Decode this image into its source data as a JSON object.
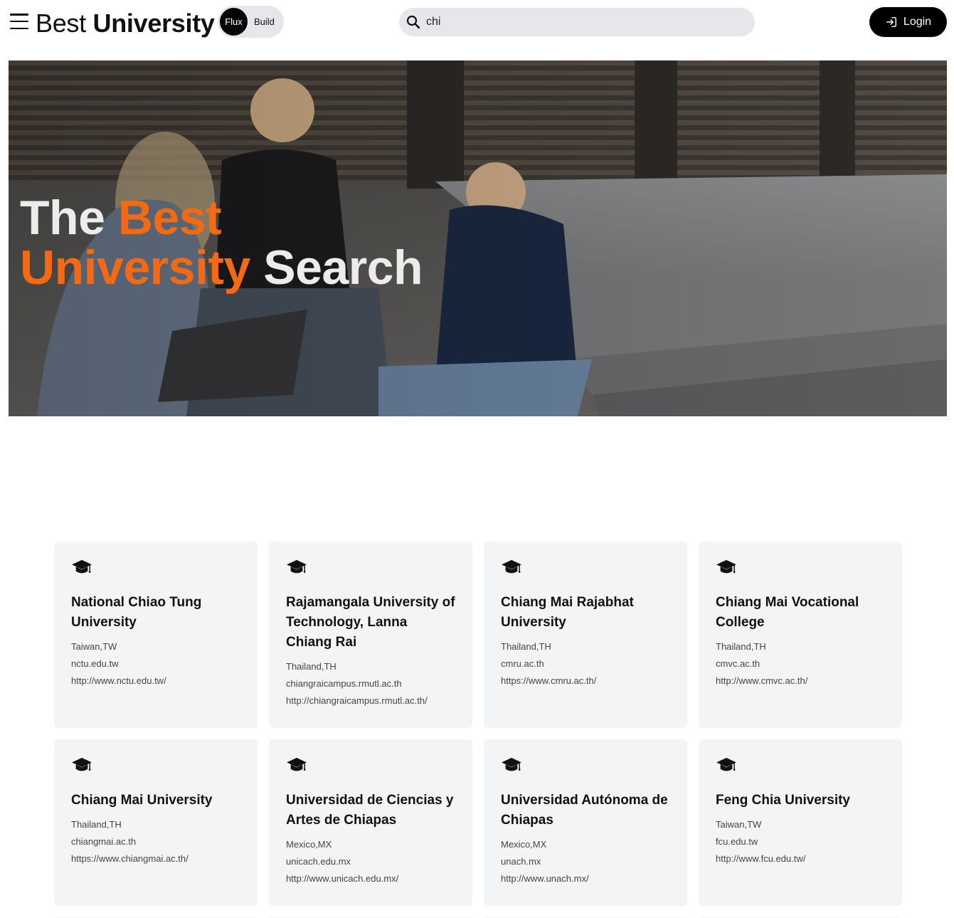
{
  "header": {
    "brand_light": "Best",
    "brand_bold": "University",
    "toggle": {
      "active": "Flux",
      "inactive": "Build"
    },
    "search": {
      "value": "chi",
      "icon": "search-icon"
    },
    "login_label": "Login"
  },
  "hero": {
    "title_word_1": "The",
    "title_word_2": "Best",
    "title_word_3": "University",
    "title_word_4": "Search"
  },
  "colors": {
    "accent": "#f46a12",
    "card_bg": "#f3f4f6",
    "button_bg": "#000000"
  },
  "universities": [
    {
      "name": "National Chiao Tung University",
      "country": "Taiwan,TW",
      "domain": "nctu.edu.tw",
      "url": "http://www.nctu.edu.tw/"
    },
    {
      "name": "Rajamangala University of Technology, Lanna Chiang Rai",
      "country": "Thailand,TH",
      "domain": "chiangraicampus.rmutl.ac.th",
      "url": "http://chiangraicampus.rmutl.ac.th/"
    },
    {
      "name": "Chiang Mai Rajabhat University",
      "country": "Thailand,TH",
      "domain": "cmru.ac.th",
      "url": "https://www.cmru.ac.th/"
    },
    {
      "name": "Chiang Mai Vocational College",
      "country": "Thailand,TH",
      "domain": "cmvc.ac.th",
      "url": "http://www.cmvc.ac.th/"
    },
    {
      "name": "Chiang Mai University",
      "country": "Thailand,TH",
      "domain": "chiangmai.ac.th",
      "url": "https://www.chiangmai.ac.th/"
    },
    {
      "name": "Universidad de Ciencias y Artes de Chiapas",
      "country": "Mexico,MX",
      "domain": "unicach.edu.mx",
      "url": "http://www.unicach.edu.mx/"
    },
    {
      "name": "Universidad Autónoma de Chiapas",
      "country": "Mexico,MX",
      "domain": "unach.mx",
      "url": "http://www.unach.mx/"
    },
    {
      "name": "Feng Chia University",
      "country": "Taiwan,TW",
      "domain": "fcu.edu.tw",
      "url": "http://www.fcu.edu.tw/"
    }
  ],
  "card_icon": "graduation-cap-icon"
}
